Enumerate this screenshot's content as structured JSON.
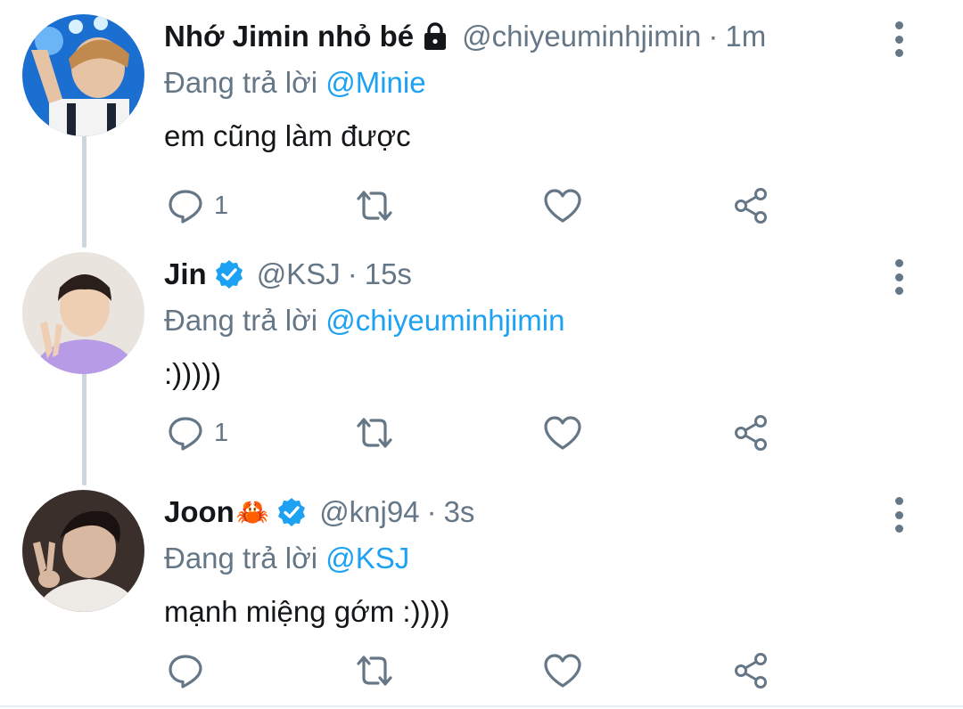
{
  "tweets": [
    {
      "name": "Nhớ Jimin nhỏ bé",
      "badge": "lock-icon",
      "name_emoji": "",
      "handle": "@chiyeuminhjimin",
      "separator": "·",
      "time": "1m",
      "replying_prefix": "Đang trả lời",
      "replying_to": "@Minie",
      "text": "em cũng làm được",
      "reply_count": "1"
    },
    {
      "name": "Jin",
      "badge": "verified-icon",
      "name_emoji": "",
      "handle": "@KSJ",
      "separator": "·",
      "time": "15s",
      "replying_prefix": "Đang trả lời",
      "replying_to": "@chiyeuminhjimin",
      "text": ":)))))",
      "reply_count": "1"
    },
    {
      "name": "Joon",
      "badge": "verified-icon",
      "name_emoji": "🦀",
      "handle": "@knj94",
      "separator": "·",
      "time": "3s",
      "replying_prefix": "Đang trả lời",
      "replying_to": "@KSJ",
      "text": "mạnh miệng gớm :))))",
      "reply_count": ""
    }
  ],
  "colors": {
    "link": "#1da1f2",
    "secondary_text": "#657786",
    "thread_line": "#ccd6dd",
    "verified": "#1da1f2"
  }
}
